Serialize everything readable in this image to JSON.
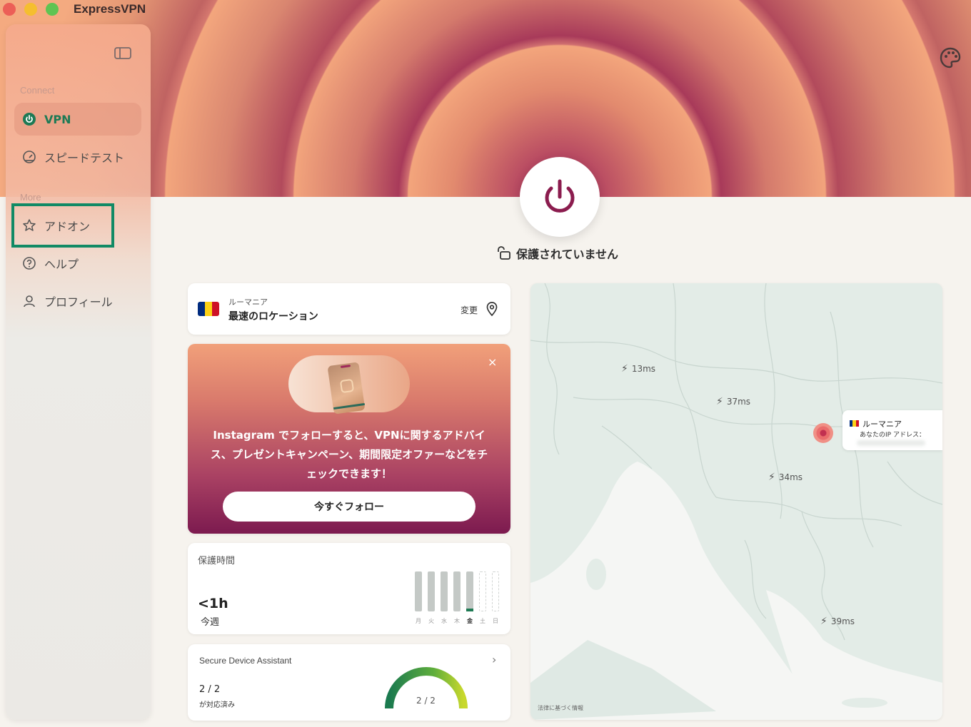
{
  "app": {
    "title": "ExpressVPN"
  },
  "titlebar": {
    "colors": {
      "close": "#ec5f57",
      "minimize": "#f5be2f",
      "zoom": "#5fc452"
    }
  },
  "sidebar": {
    "sections": [
      {
        "label": "Connect"
      },
      {
        "label": "More"
      }
    ],
    "items": [
      {
        "label": "VPN",
        "icon": "power-icon",
        "active": true
      },
      {
        "label": "スピードテスト",
        "icon": "speedometer-icon"
      },
      {
        "label": "アドオン",
        "icon": "star-icon",
        "highlighted": true
      },
      {
        "label": "ヘルプ",
        "icon": "help-circle-icon"
      },
      {
        "label": "プロフィール",
        "icon": "user-icon"
      }
    ]
  },
  "connection": {
    "status": "保護されていません",
    "location": {
      "country": "ルーマニア",
      "name": "最速のロケーション",
      "change_label": "変更",
      "flag_colors": [
        "#002b7f",
        "#fcd116",
        "#ce1126"
      ]
    }
  },
  "promo": {
    "text": "Instagram でフォローすると、VPNに関するアドバイス、プレゼントキャンペーン、期間限定オファーなどをチェックできます！",
    "button_label": "今すぐフォロー",
    "close_label": "×"
  },
  "protection_time": {
    "title": "保護時間",
    "value": "<1h",
    "period": "今週",
    "days": [
      "月",
      "火",
      "水",
      "木",
      "金",
      "土",
      "日"
    ]
  },
  "secure_device_assistant": {
    "title": "Secure Device Assistant",
    "count": "2 / 2",
    "status": "が対応済み",
    "gauge_label": "2 / 2",
    "gauge_fraction": 1.0
  },
  "map": {
    "latencies": [
      "13ms",
      "37ms",
      "34ms",
      "39ms"
    ],
    "popup": {
      "country": "ルーマニア",
      "ip_label": "あなたのIP アドレス："
    },
    "footnote": "法律に基づく情報"
  },
  "colors": {
    "accent": "#1d7a55",
    "power": "#8b1c4e",
    "highlight": "#118a65"
  }
}
